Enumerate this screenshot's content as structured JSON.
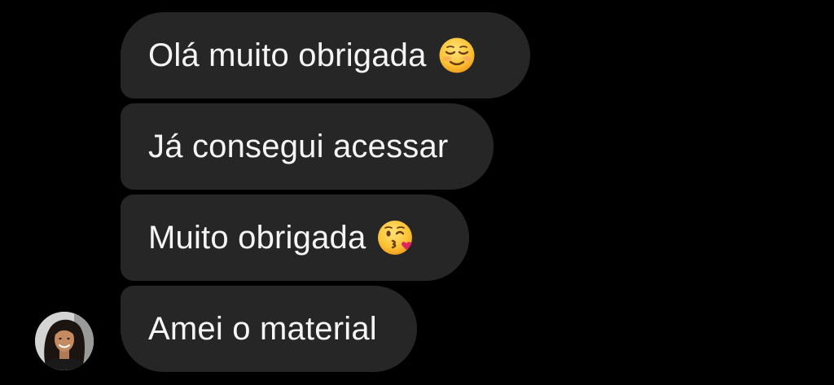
{
  "conversation": {
    "messages": [
      {
        "text": "Olá muito obrigada",
        "emoji": "relieved-smiling-face-emoji"
      },
      {
        "text": "Já consegui acessar",
        "emoji": null
      },
      {
        "text": "Muito obrigada",
        "emoji": "face-blowing-kiss-emoji"
      },
      {
        "text": "Amei o material",
        "emoji": null
      }
    ],
    "sender_avatar": "profile-photo-avatar"
  },
  "colors": {
    "background": "#000000",
    "bubble": "#262626",
    "text": "#f5f5f5",
    "emoji_face": "#ffcc33",
    "heart": "#e0245e"
  }
}
